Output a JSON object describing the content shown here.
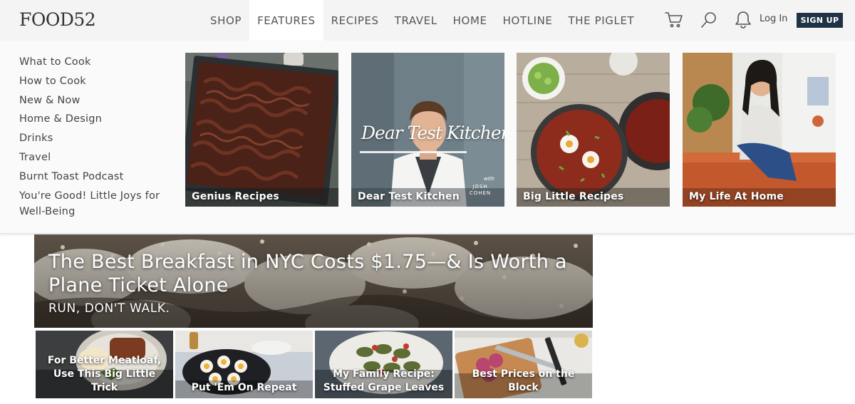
{
  "header": {
    "logo": "FOOD52",
    "nav": [
      "SHOP",
      "FEATURES",
      "RECIPES",
      "TRAVEL",
      "HOME",
      "HOTLINE",
      "THE PIGLET"
    ],
    "active_nav": "FEATURES",
    "icons": [
      "cart-icon",
      "search-icon",
      "bell-icon"
    ],
    "login_label": "Log In",
    "signup_label": "SIGN UP"
  },
  "dropdown": {
    "menu": [
      "What to Cook",
      "How to Cook",
      "New & Now",
      "Home & Design",
      "Drinks",
      "Travel",
      "Burnt Toast Podcast",
      "You're Good! Little Joys for Well-Being"
    ],
    "cards": [
      {
        "title": "Genius Recipes"
      },
      {
        "title": "Dear Test Kitchen",
        "overlay": "Dear Test Kitchen",
        "byline_with": "with",
        "byline_name": "JOSH COHEN"
      },
      {
        "title": "Big Little Recipes"
      },
      {
        "title": "My Life At Home"
      }
    ]
  },
  "hero": {
    "title": "The Best Breakfast in NYC Costs $1.75—& Is Worth a Plane Ticket Alone",
    "subtitle": "RUN, DON'T WALK."
  },
  "tiles": [
    {
      "title": "For Better Meatloaf, Use This Big Little Trick"
    },
    {
      "title": "Put 'Em On Repeat"
    },
    {
      "title": "My Family Recipe: Stuffed Grape Leaves"
    },
    {
      "title": "Best Prices on the Block"
    }
  ],
  "colors": {
    "header_bg": "#f4f4f4",
    "signup_bg": "#1f3345",
    "dropdown_bg": "#fafafa"
  }
}
